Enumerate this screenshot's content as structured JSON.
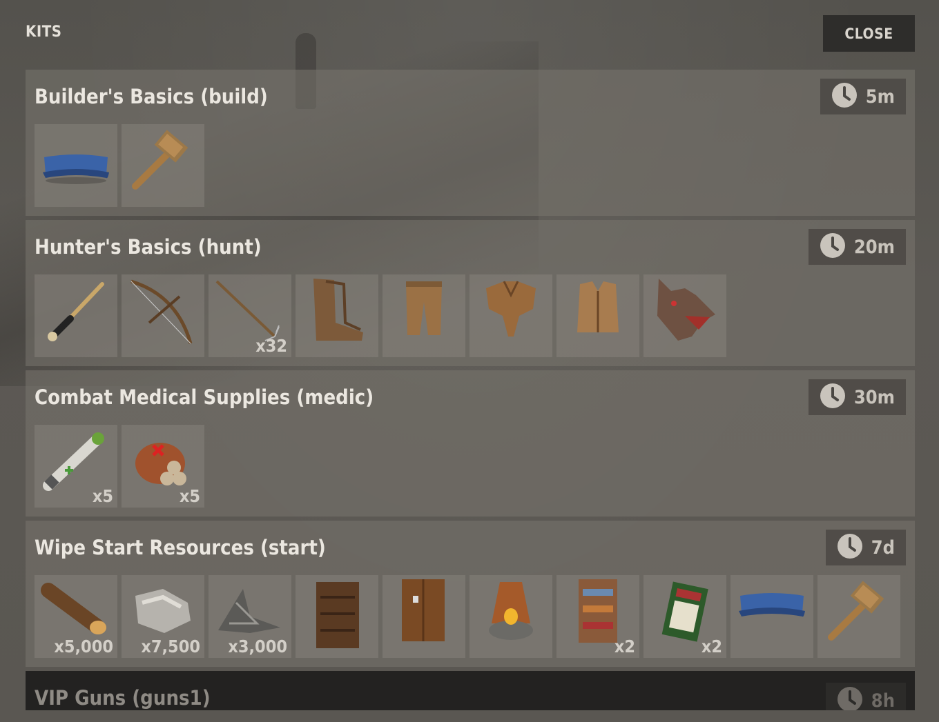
{
  "header": {
    "title": "KITS",
    "close_label": "CLOSE"
  },
  "kits": [
    {
      "title": "Builder's Basics (build)",
      "cooldown": "5m",
      "items": [
        {
          "icon": "blueprint-icon",
          "qty": ""
        },
        {
          "icon": "hammer-icon",
          "qty": ""
        }
      ]
    },
    {
      "title": "Hunter's Basics (hunt)",
      "cooldown": "20m",
      "items": [
        {
          "icon": "bone-knife-icon",
          "qty": ""
        },
        {
          "icon": "bow-icon",
          "qty": ""
        },
        {
          "icon": "arrow-icon",
          "qty": "x32"
        },
        {
          "icon": "hide-boots-icon",
          "qty": ""
        },
        {
          "icon": "hide-pants-icon",
          "qty": ""
        },
        {
          "icon": "hide-poncho-icon",
          "qty": ""
        },
        {
          "icon": "hide-vest-icon",
          "qty": ""
        },
        {
          "icon": "wolf-headdress-icon",
          "qty": ""
        }
      ]
    },
    {
      "title": "Combat Medical Supplies (medic)",
      "cooldown": "30m",
      "items": [
        {
          "icon": "medical-syringe-icon",
          "qty": "x5"
        },
        {
          "icon": "bandage-roll-icon",
          "qty": "x5"
        }
      ]
    },
    {
      "title": "Wipe Start Resources (start)",
      "cooldown": "7d",
      "items": [
        {
          "icon": "wood-log-icon",
          "qty": "x5,000"
        },
        {
          "icon": "stones-icon",
          "qty": "x7,500"
        },
        {
          "icon": "metal-fragments-icon",
          "qty": "x3,000"
        },
        {
          "icon": "wooden-shelf-icon",
          "qty": ""
        },
        {
          "icon": "wooden-door-icon",
          "qty": ""
        },
        {
          "icon": "furnace-icon",
          "qty": ""
        },
        {
          "icon": "bookshelf-icon",
          "qty": "x2"
        },
        {
          "icon": "code-lock-calculator-icon",
          "qty": "x2"
        },
        {
          "icon": "blueprint-icon",
          "qty": ""
        },
        {
          "icon": "hammer-icon",
          "qty": ""
        }
      ]
    },
    {
      "title": "VIP Guns (guns1)",
      "cooldown": "8h",
      "items": []
    }
  ]
}
